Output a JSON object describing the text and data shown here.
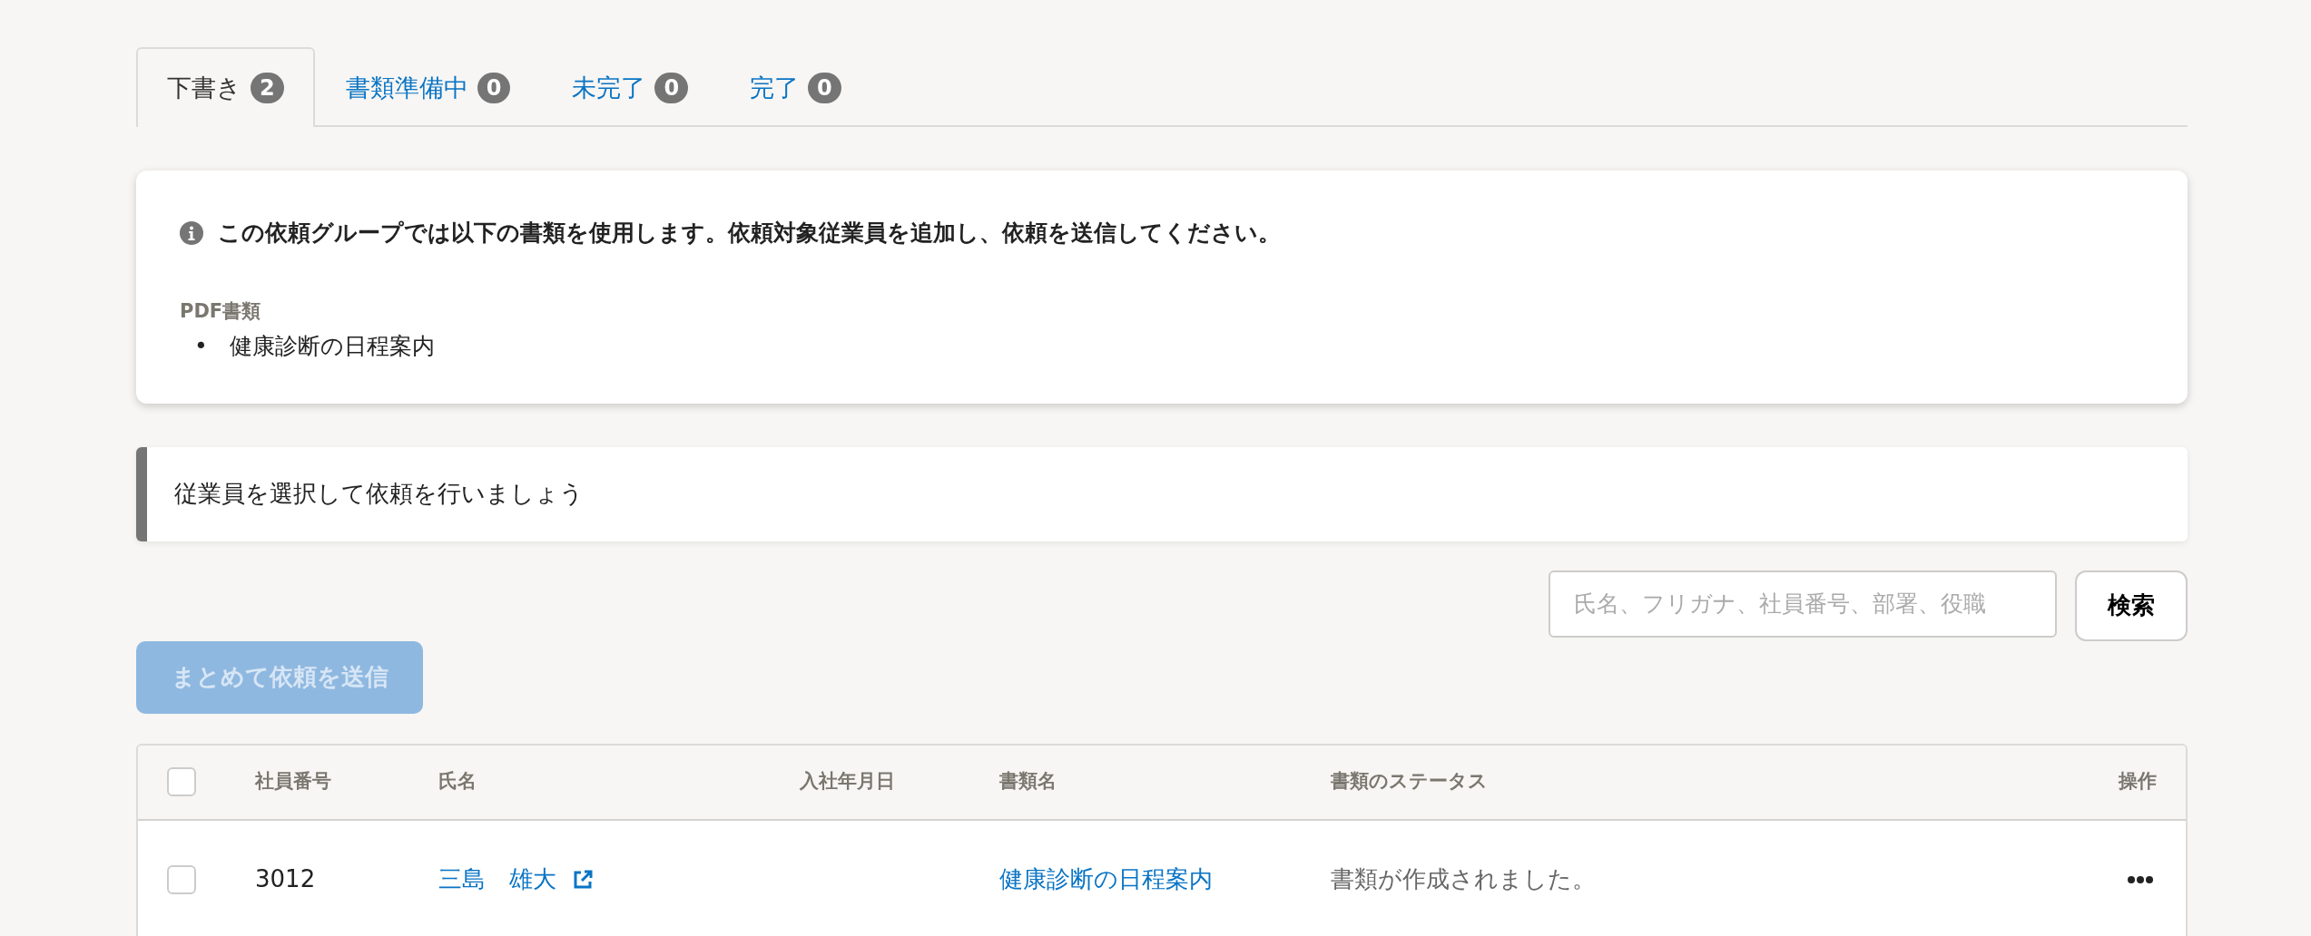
{
  "tabs": [
    {
      "label": "下書き",
      "count": "2",
      "selected": true
    },
    {
      "label": "書類準備中",
      "count": "0",
      "selected": false
    },
    {
      "label": "未完了",
      "count": "0",
      "selected": false
    },
    {
      "label": "完了",
      "count": "0",
      "selected": false
    }
  ],
  "info": {
    "message": "この依頼グループでは以下の書類を使用します。依頼対象従業員を追加し、依頼を送信してください。",
    "section_label": "PDF書類",
    "documents": [
      {
        "bullet": "•",
        "text": "健康診断の日程案内"
      }
    ]
  },
  "prompt": "従業員を選択して依頼を行いましょう",
  "search": {
    "placeholder": "氏名、フリガナ、社員番号、部署、役職",
    "button": "検索"
  },
  "bulk_button": {
    "label": "まとめて依頼を送信",
    "disabled": true
  },
  "table": {
    "select_all": {
      "checked": false
    },
    "columns": [
      "社員番号",
      "氏名",
      "入社年月日",
      "書類名",
      "書類のステータス",
      "操作"
    ],
    "rows": [
      {
        "checked": false,
        "employee_no": "3012",
        "name": "三島　雄大",
        "document": "健康診断の日程案内",
        "status": "書類が作成されました。"
      }
    ]
  }
}
